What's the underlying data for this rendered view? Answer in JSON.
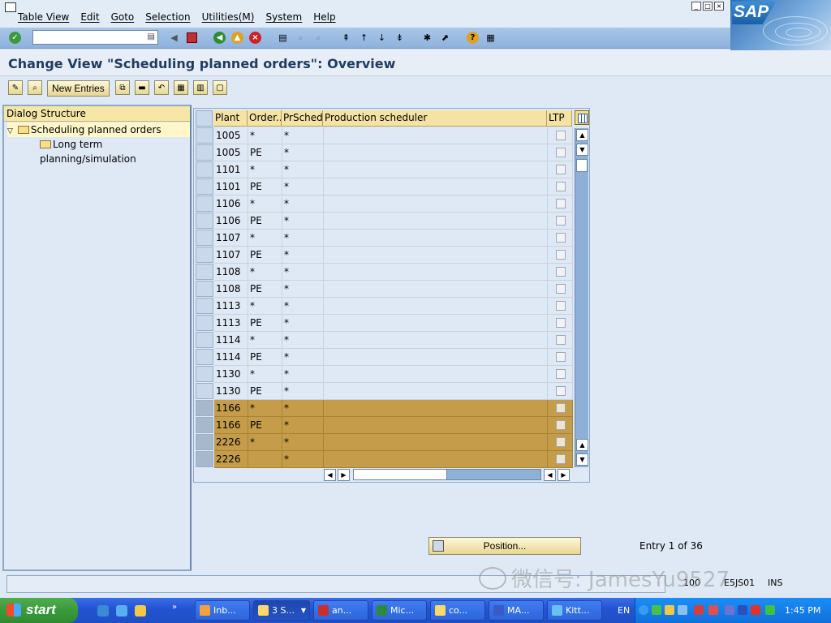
{
  "menubar": {
    "items": [
      {
        "label": "Table View"
      },
      {
        "label": "Edit"
      },
      {
        "label": "Goto"
      },
      {
        "label": "Selection"
      },
      {
        "label": "Utilities(M)"
      },
      {
        "label": "System"
      },
      {
        "label": "Help"
      }
    ],
    "logo": "SAP"
  },
  "command_field": {
    "value": ""
  },
  "title": "Change View \"Scheduling planned orders\": Overview",
  "app_toolbar": {
    "new_entries_label": "New Entries"
  },
  "tree": {
    "header": "Dialog Structure",
    "items": [
      {
        "label": "Scheduling planned orders",
        "selected": true
      },
      {
        "label": "Long term planning/simulation",
        "selected": false
      }
    ]
  },
  "table": {
    "columns": [
      "Plant",
      "Order...",
      "PrSched",
      "Production scheduler",
      "LTP"
    ],
    "rows": [
      {
        "plant": "1005",
        "order": "*",
        "prsched": "*",
        "scheduler": "",
        "highlight": false
      },
      {
        "plant": "1005",
        "order": "PE",
        "prsched": "*",
        "scheduler": "",
        "highlight": false
      },
      {
        "plant": "1101",
        "order": "*",
        "prsched": "*",
        "scheduler": "",
        "highlight": false
      },
      {
        "plant": "1101",
        "order": "PE",
        "prsched": "*",
        "scheduler": "",
        "highlight": false
      },
      {
        "plant": "1106",
        "order": "*",
        "prsched": "*",
        "scheduler": "",
        "highlight": false
      },
      {
        "plant": "1106",
        "order": "PE",
        "prsched": "*",
        "scheduler": "",
        "highlight": false
      },
      {
        "plant": "1107",
        "order": "*",
        "prsched": "*",
        "scheduler": "",
        "highlight": false
      },
      {
        "plant": "1107",
        "order": "PE",
        "prsched": "*",
        "scheduler": "",
        "highlight": false
      },
      {
        "plant": "1108",
        "order": "*",
        "prsched": "*",
        "scheduler": "",
        "highlight": false
      },
      {
        "plant": "1108",
        "order": "PE",
        "prsched": "*",
        "scheduler": "",
        "highlight": false
      },
      {
        "plant": "1113",
        "order": "*",
        "prsched": "*",
        "scheduler": "",
        "highlight": false
      },
      {
        "plant": "1113",
        "order": "PE",
        "prsched": "*",
        "scheduler": "",
        "highlight": false
      },
      {
        "plant": "1114",
        "order": "*",
        "prsched": "*",
        "scheduler": "",
        "highlight": false
      },
      {
        "plant": "1114",
        "order": "PE",
        "prsched": "*",
        "scheduler": "",
        "highlight": false
      },
      {
        "plant": "1130",
        "order": "*",
        "prsched": "*",
        "scheduler": "",
        "highlight": false
      },
      {
        "plant": "1130",
        "order": "PE",
        "prsched": "*",
        "scheduler": "",
        "highlight": false
      },
      {
        "plant": "1166",
        "order": "*",
        "prsched": "*",
        "scheduler": "",
        "highlight": true
      },
      {
        "plant": "1166",
        "order": "PE",
        "prsched": "*",
        "scheduler": "",
        "highlight": true
      },
      {
        "plant": "2226",
        "order": "*",
        "prsched": "*",
        "scheduler": "",
        "highlight": true
      },
      {
        "plant": "2226",
        "order": "",
        "prsched": "*",
        "scheduler": "",
        "highlight": true
      }
    ]
  },
  "position_button": {
    "label": "Position..."
  },
  "entry_info": "Entry 1 of 36",
  "statusbar": {
    "client": "100",
    "server": "E5JS01",
    "mode": "INS"
  },
  "watermark": "微信号: JamesYu9527",
  "taskbar": {
    "start_label": "start",
    "tasks": [
      {
        "label": "Inb...",
        "active": false
      },
      {
        "label": "3 S...",
        "active": true
      },
      {
        "label": "an...",
        "active": false
      },
      {
        "label": "Mic...",
        "active": false
      },
      {
        "label": "co...",
        "active": false
      },
      {
        "label": "MA...",
        "active": false
      },
      {
        "label": "Kitt...",
        "active": false
      }
    ],
    "lang": "EN",
    "clock": "1:45 PM"
  }
}
